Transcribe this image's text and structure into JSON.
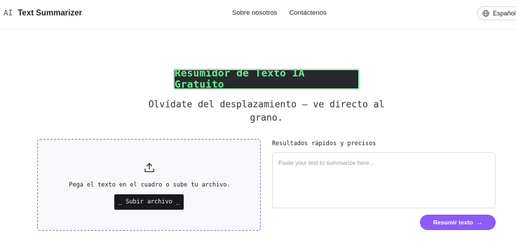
{
  "header": {
    "logo_mark": "AI",
    "app_name": "Text Summarizer",
    "nav": [
      "Sobre nosotros",
      "Contáctenos"
    ],
    "language": "Español"
  },
  "hero": {
    "badge": "Resumidor de Texto IA Gratuito",
    "tagline": "Olvídate del desplazamiento — ve directo al grano."
  },
  "upload": {
    "hint": "Pega el texto en el cuadro o sube tu archivo.",
    "button_label": "_ Subir archivo _"
  },
  "results": {
    "label": "Resultados rápidos y precisos",
    "placeholder": "Paste your text to summarize here...",
    "submit_label": "Resumir texto",
    "submit_arrow": "→"
  },
  "colors": {
    "accent": "#8b5cf6",
    "badge_bg": "#262a2d",
    "badge_text": "#6ee893",
    "upload_border": "#8d7ad9"
  },
  "icons": [
    "globe-icon",
    "upload-icon",
    "arrow-right-icon"
  ]
}
